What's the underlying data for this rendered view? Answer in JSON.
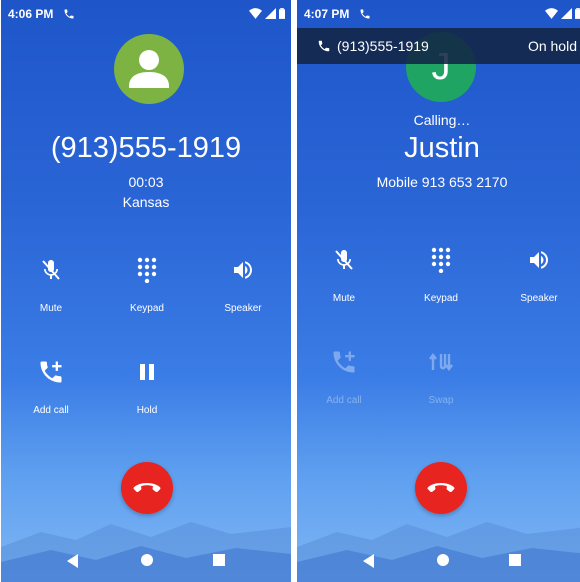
{
  "left": {
    "status": {
      "time": "4:06 PM"
    },
    "number": "(913)555-1919",
    "timer": "00:03",
    "location": "Kansas",
    "controls": {
      "mute": "Mute",
      "keypad": "Keypad",
      "speaker": "Speaker",
      "add_call": "Add call",
      "hold": "Hold"
    }
  },
  "right": {
    "status": {
      "time": "4:07 PM"
    },
    "hold_banner": {
      "number": "(913)555-1919",
      "state": "On hold"
    },
    "avatar_letter": "J",
    "calling": "Calling…",
    "name": "Justin",
    "sub": "Mobile 913 653 2170",
    "controls": {
      "mute": "Mute",
      "keypad": "Keypad",
      "speaker": "Speaker",
      "add_call": "Add call",
      "swap": "Swap"
    }
  },
  "colors": {
    "hangup": "#e82420",
    "avatar_left": "#7cb342",
    "avatar_right": "#1fa463"
  }
}
